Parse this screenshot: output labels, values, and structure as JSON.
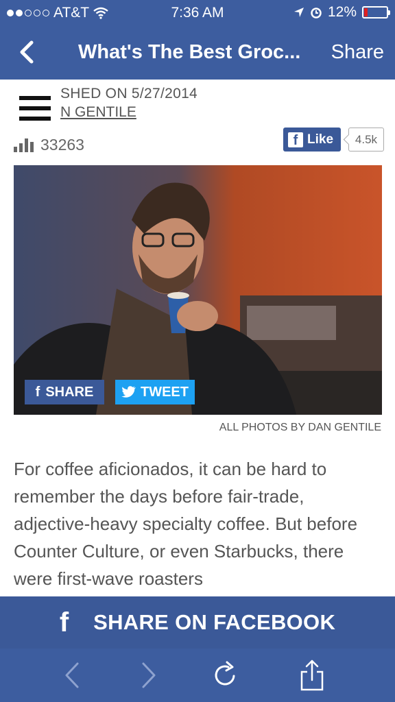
{
  "status": {
    "carrier": "AT&T",
    "time": "7:36 AM",
    "battery": "12%"
  },
  "nav": {
    "title": "What's The Best Groc...",
    "share_label": "Share"
  },
  "article": {
    "published": "SHED ON 5/27/2014",
    "author": "N GENTILE",
    "views": "33263",
    "like_label": "Like",
    "like_count": "4.5k",
    "photo_credit": "ALL PHOTOS BY DAN GENTILE",
    "share_button": "SHARE",
    "tweet_button": "TWEET",
    "body": "For coffee aficionados, it can be hard to remember the days before fair-trade, adjective-heavy specialty coffee. But before Counter Culture, or even Starbucks, there were first-wave roasters"
  },
  "facebook_bar": {
    "label": "SHARE ON FACEBOOK"
  },
  "toolbar": {
    "icons": [
      "back-arrow-icon",
      "forward-arrow-icon",
      "reload-icon",
      "share-icon"
    ]
  },
  "colors": {
    "nav": "#3d5d9f",
    "facebook": "#3b5998",
    "twitter": "#1da1f2",
    "battery_low": "#e02020"
  }
}
